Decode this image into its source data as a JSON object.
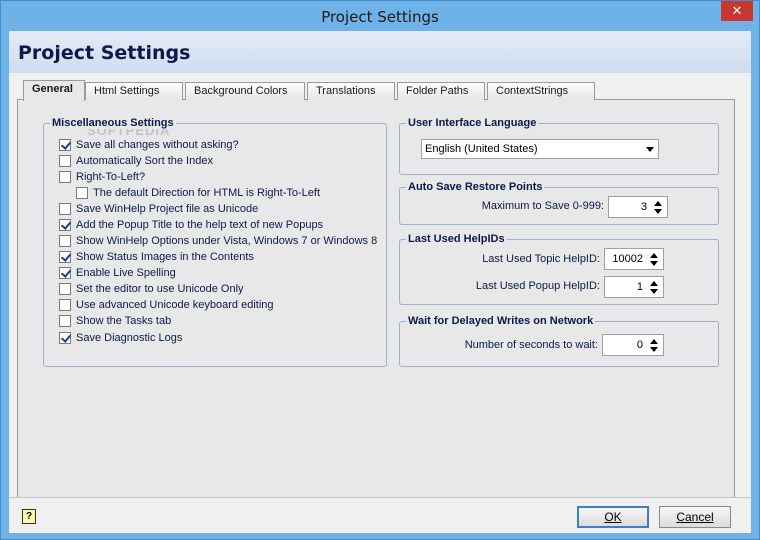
{
  "window": {
    "title": "Project Settings",
    "close_glyph": "✕"
  },
  "header": {
    "title": "Project Settings"
  },
  "watermark": "SOFTPEDIA",
  "tabs": [
    {
      "label": "General",
      "active": true
    },
    {
      "label": "Html Settings"
    },
    {
      "label": "Background Colors"
    },
    {
      "label": "Translations"
    },
    {
      "label": "Folder Paths"
    },
    {
      "label": "ContextStrings"
    }
  ],
  "misc": {
    "title": "Miscellaneous Settings",
    "items": [
      {
        "label": "Save all changes without asking?",
        "checked": true
      },
      {
        "label": "Automatically Sort the Index",
        "checked": false
      },
      {
        "label": "Right-To-Left?",
        "checked": false
      },
      {
        "label": "The default Direction for HTML is Right-To-Left",
        "checked": false
      },
      {
        "label": "Save WinHelp Project file as Unicode",
        "checked": false
      },
      {
        "label": "Add the Popup Title to the help text of new Popups",
        "checked": true
      },
      {
        "label": "Show WinHelp Options under Vista, Windows 7 or Windows 8",
        "checked": false
      },
      {
        "label": "Show Status Images in the Contents",
        "checked": true
      },
      {
        "label": "Enable Live Spelling",
        "checked": true
      },
      {
        "label": "Set the editor to use Unicode Only",
        "checked": false
      },
      {
        "label": "Use advanced Unicode keyboard editing",
        "checked": false
      },
      {
        "label": "Show the Tasks tab",
        "checked": false
      },
      {
        "label": "Save Diagnostic Logs",
        "checked": true
      }
    ]
  },
  "ui_language": {
    "title": "User Interface Language",
    "selected": "English (United States)"
  },
  "auto_save": {
    "title": "Auto Save Restore Points",
    "label": "Maximum to Save 0-999:",
    "value": "3"
  },
  "helpids": {
    "title": "Last Used HelpIDs",
    "topic_label": "Last Used Topic HelpID:",
    "topic_value": "10002",
    "popup_label": "Last Used Popup HelpID:",
    "popup_value": "1"
  },
  "delayed_writes": {
    "title": "Wait for Delayed Writes on Network",
    "label": "Number of seconds to wait:",
    "value": "0"
  },
  "buttons": {
    "ok": "OK",
    "cancel": "Cancel",
    "help_glyph": "?"
  }
}
